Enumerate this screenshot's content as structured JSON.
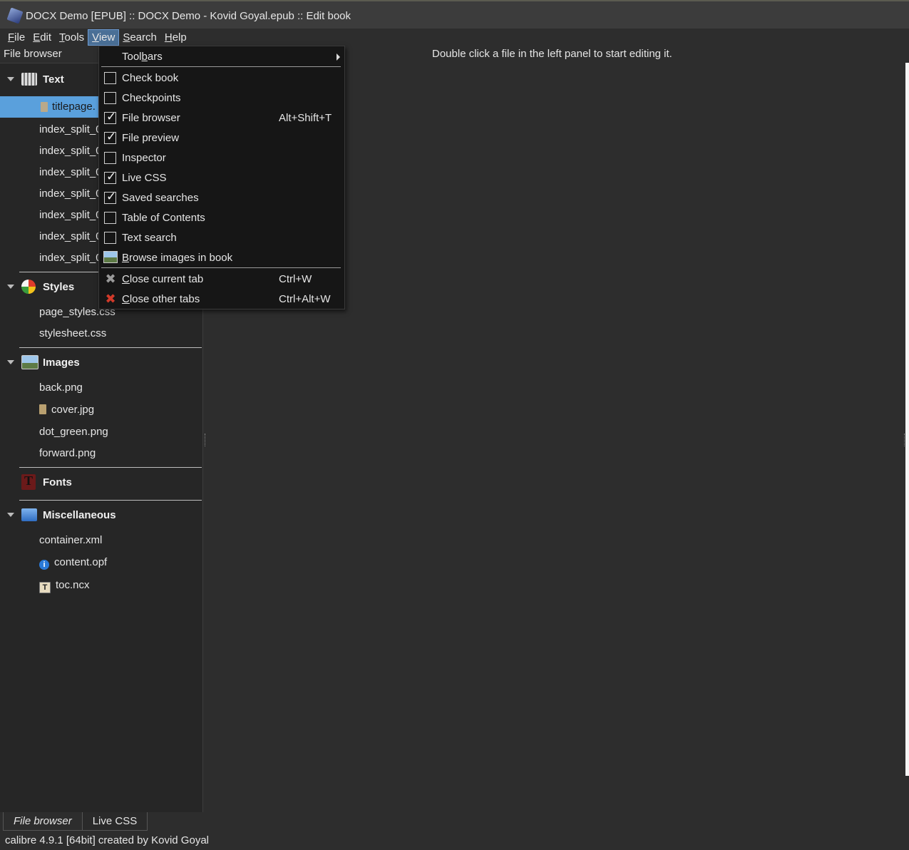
{
  "window": {
    "title": "DOCX Demo [EPUB] :: DOCX Demo - Kovid Goyal.epub :: Edit book"
  },
  "menubar": {
    "items": [
      {
        "label": "File",
        "accel": "F",
        "rest": "ile"
      },
      {
        "label": "Edit",
        "accel": "E",
        "rest": "dit"
      },
      {
        "label": "Tools",
        "accel": "T",
        "rest": "ools"
      },
      {
        "label": "View",
        "accel": "V",
        "rest": "iew"
      },
      {
        "label": "Search",
        "accel": "S",
        "rest": "earch"
      },
      {
        "label": "Help",
        "accel": "H",
        "rest": "elp"
      }
    ]
  },
  "file_browser": {
    "title": "File browser",
    "categories": {
      "text": {
        "label": "Text",
        "icon": "text-files-icon",
        "files": [
          "titlepage.",
          "index_split_0",
          "index_split_0",
          "index_split_0",
          "index_split_0",
          "index_split_0",
          "index_split_0",
          "index_split_0"
        ]
      },
      "styles": {
        "label": "Styles",
        "icon": "styles-icon",
        "files": [
          "page_styles.css",
          "stylesheet.css"
        ]
      },
      "images": {
        "label": "Images",
        "icon": "images-icon",
        "files": [
          "back.png",
          "cover.jpg",
          "dot_green.png",
          "forward.png"
        ]
      },
      "fonts": {
        "label": "Fonts",
        "icon": "fonts-icon"
      },
      "misc": {
        "label": "Miscellaneous",
        "icon": "folder-icon",
        "files": [
          "container.xml",
          "content.opf",
          "toc.ncx"
        ]
      }
    }
  },
  "view_menu": {
    "toolbars": {
      "pre": "Tool",
      "accel": "b",
      "post": "ars"
    },
    "items": [
      {
        "label": "Check book",
        "checked": false
      },
      {
        "label": "Checkpoints",
        "checked": false
      },
      {
        "label": "File browser",
        "checked": true,
        "shortcut": "Alt+Shift+T"
      },
      {
        "label": "File preview",
        "checked": true
      },
      {
        "label": "Inspector",
        "checked": false
      },
      {
        "label": "Live CSS",
        "checked": true
      },
      {
        "label": "Saved searches",
        "checked": true
      },
      {
        "label": "Table of Contents",
        "checked": false
      },
      {
        "label": "Text search",
        "checked": false
      }
    ],
    "browse_images": {
      "accel": "B",
      "rest": "rowse images in book",
      "icon": "image-icon"
    },
    "close_current": {
      "accel": "C",
      "rest": "lose current tab",
      "shortcut": "Ctrl+W",
      "icon": "close-x-icon"
    },
    "close_other": {
      "accel": "C",
      "rest": "lose other tabs",
      "shortcut": "Ctrl+Alt+W",
      "icon": "close-others-icon"
    }
  },
  "editor": {
    "hint": "Double click a file in the left panel to start editing it."
  },
  "bottom_tabs": [
    "File browser",
    "Live CSS"
  ],
  "status": "calibre 4.9.1 [64bit] created by Kovid Goyal"
}
